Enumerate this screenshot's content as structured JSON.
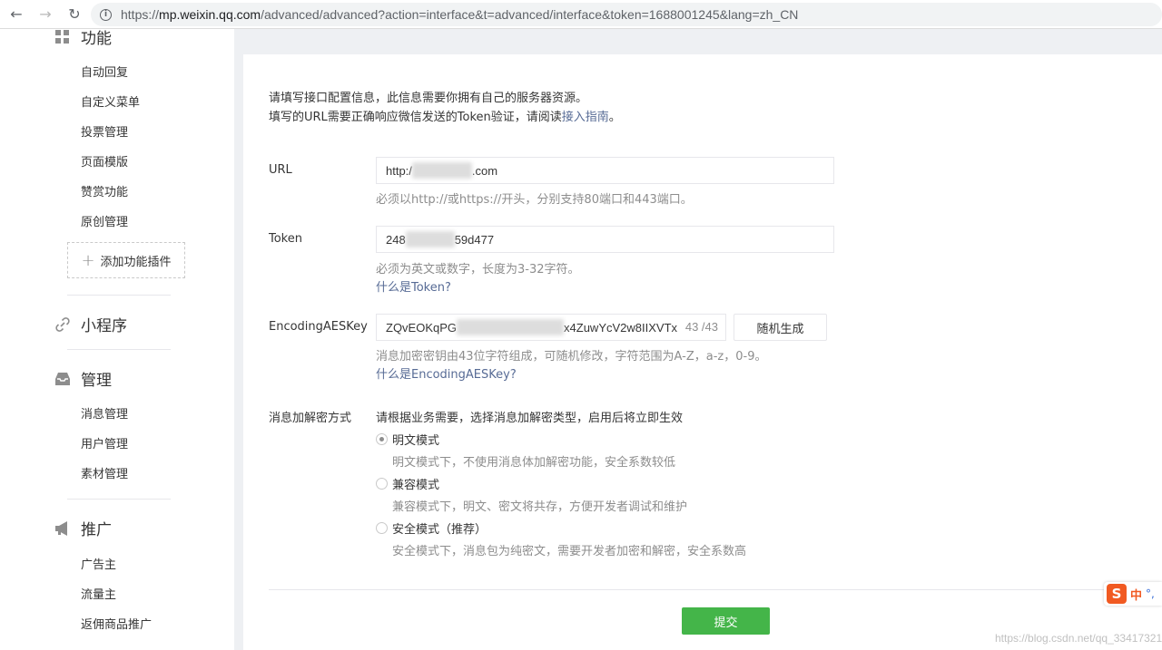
{
  "browser": {
    "url_scheme": "https://",
    "url_host": "mp.weixin.qq.com",
    "url_path": "/advanced/advanced?action=interface&t=advanced/interface&token=1688001245&lang=zh_CN"
  },
  "sidebar": {
    "sections": [
      {
        "title": "功能",
        "icon": "grid-icon",
        "items": [
          "自动回复",
          "自定义菜单",
          "投票管理",
          "页面模版",
          "赞赏功能",
          "原创管理"
        ],
        "add_plugin_label": "添加功能插件"
      },
      {
        "title": "小程序",
        "icon": "link-icon",
        "items": []
      },
      {
        "title": "管理",
        "icon": "inbox-icon",
        "items": [
          "消息管理",
          "用户管理",
          "素材管理"
        ]
      },
      {
        "title": "推广",
        "icon": "megaphone-icon",
        "items": [
          "广告主",
          "流量主",
          "返佣商品推广"
        ]
      }
    ]
  },
  "form": {
    "intro_line1": "请填写接口配置信息，此信息需要你拥有自己的服务器资源。",
    "intro_line2_prefix": "填写的URL需要正确响应微信发送的Token验证，请阅读",
    "intro_line2_link": "接入指南",
    "intro_line2_suffix": "。",
    "url": {
      "label": "URL",
      "value_prefix": "http:/",
      "value_suffix": ".com",
      "hint": "必须以http://或https://开头，分别支持80端口和443端口。"
    },
    "token": {
      "label": "Token",
      "value_prefix": "248",
      "value_suffix": "59d477",
      "hint": "必须为英文或数字，长度为3-32字符。",
      "help_link": "什么是Token?"
    },
    "aes_key": {
      "label": "EncodingAESKey",
      "value_prefix": "ZQvEOKqPG",
      "value_suffix": "x4ZuwYcV2w8IIXVTx",
      "counter": "43 /43",
      "generate_button": "随机生成",
      "hint": "消息加密密钥由43位字符组成，可随机修改，字符范围为A-Z，a-z，0-9。",
      "help_link": "什么是EncodingAESKey?"
    },
    "encryption": {
      "label": "消息加解密方式",
      "description": "请根据业务需要，选择消息加解密类型，启用后将立即生效",
      "options": [
        {
          "label": "明文模式",
          "desc": "明文模式下，不使用消息体加解密功能，安全系数较低",
          "checked": true
        },
        {
          "label": "兼容模式",
          "desc": "兼容模式下，明文、密文将共存，方便开发者调试和维护",
          "checked": false
        },
        {
          "label": "安全模式（推荐）",
          "desc": "安全模式下，消息包为纯密文，需要开发者加密和解密，安全系数高",
          "checked": false
        }
      ]
    },
    "submit_label": "提交"
  },
  "ime": {
    "logo": "S",
    "mode": "中",
    "punct": "°,"
  },
  "watermark": "https://blog.csdn.net/qq_33417321",
  "colors": {
    "primary": "#44b549",
    "link": "#576b95",
    "hint": "#8d8d8d"
  }
}
